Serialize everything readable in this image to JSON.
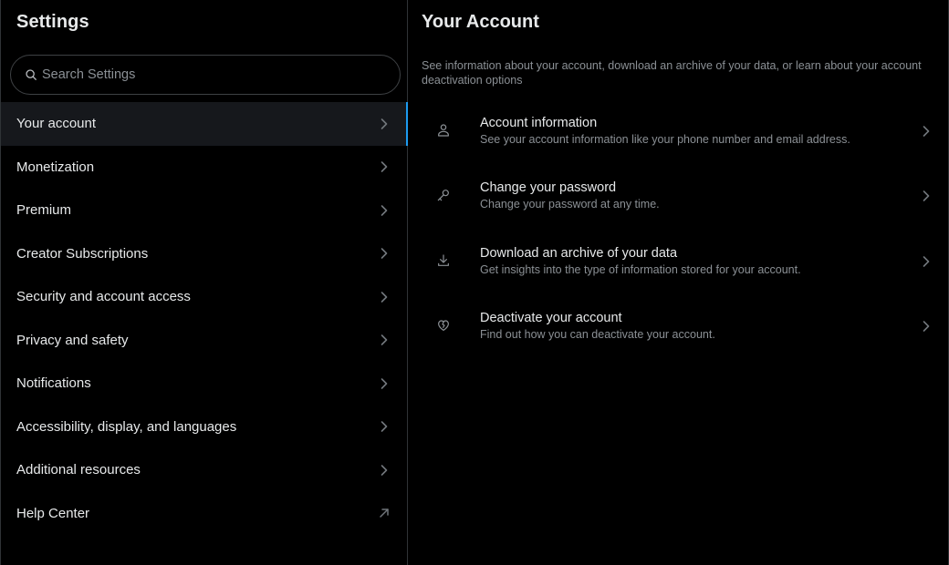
{
  "sidebar": {
    "title": "Settings",
    "search_placeholder": "Search Settings",
    "search_value": "",
    "active_index": 0,
    "items": [
      {
        "label": "Your account",
        "icon": "chevron-right-icon"
      },
      {
        "label": "Monetization",
        "icon": "chevron-right-icon"
      },
      {
        "label": "Premium",
        "icon": "chevron-right-icon"
      },
      {
        "label": "Creator Subscriptions",
        "icon": "chevron-right-icon"
      },
      {
        "label": "Security and account access",
        "icon": "chevron-right-icon"
      },
      {
        "label": "Privacy and safety",
        "icon": "chevron-right-icon"
      },
      {
        "label": "Notifications",
        "icon": "chevron-right-icon"
      },
      {
        "label": "Accessibility, display, and languages",
        "icon": "chevron-right-icon"
      },
      {
        "label": "Additional resources",
        "icon": "chevron-right-icon"
      },
      {
        "label": "Help Center",
        "icon": "external-link-arrow-icon"
      }
    ]
  },
  "main": {
    "title": "Your Account",
    "description": "See information about your account, download an archive of your data, or learn about your account deactivation options",
    "items": [
      {
        "title": "Account information",
        "subtitle": "See your account information like your phone number and email address.",
        "icon": "person-icon"
      },
      {
        "title": "Change your password",
        "subtitle": "Change your password at any time.",
        "icon": "key-icon"
      },
      {
        "title": "Download an archive of your data",
        "subtitle": "Get insights into the type of information stored for your account.",
        "icon": "download-icon"
      },
      {
        "title": "Deactivate your account",
        "subtitle": "Find out how you can deactivate your account.",
        "icon": "broken-heart-icon"
      }
    ]
  },
  "colors": {
    "background": "#000000",
    "text_primary": "#e7e9ea",
    "text_secondary": "#8b9095",
    "border": "#2f3336",
    "active_bg": "#16181c",
    "accent": "#1d9bf0"
  }
}
